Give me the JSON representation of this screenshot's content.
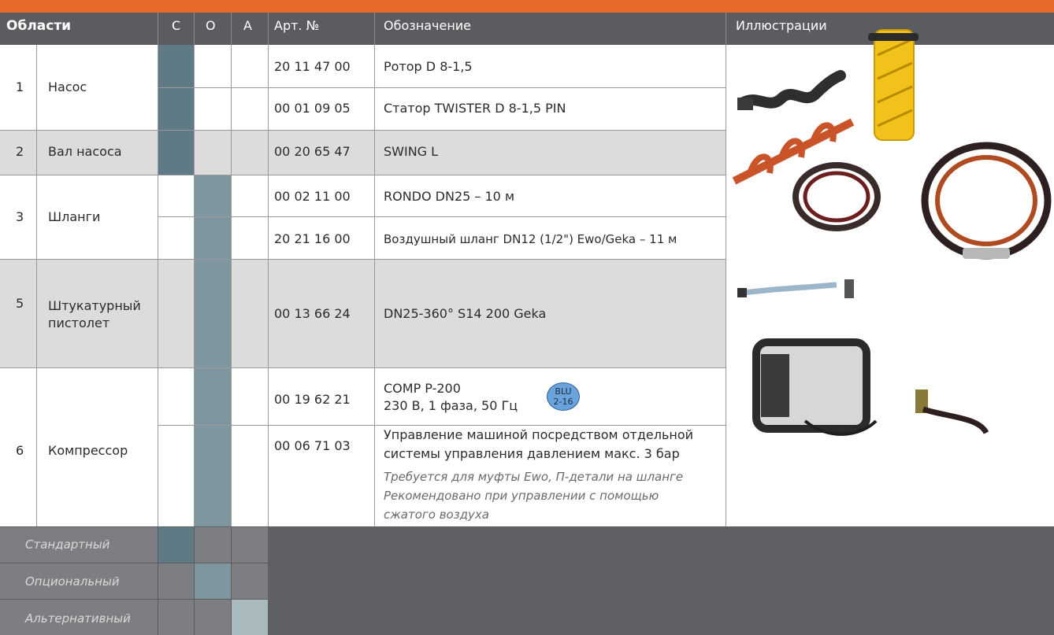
{
  "header": {
    "areas": "Области",
    "c": "С",
    "o": "О",
    "a": "А",
    "art": "Арт. №",
    "designation": "Обозначение",
    "illustrations": "Иллюстрации"
  },
  "rows": [
    {
      "num": "1",
      "area": "Насос",
      "items": [
        {
          "art": "20 11 47 00",
          "desc": "Ротор D 8-1,5"
        },
        {
          "art": "00 01 09 05",
          "desc": "Статор TWISTER D 8-1,5 PIN"
        }
      ]
    },
    {
      "num": "2",
      "area": "Вал насоса",
      "items": [
        {
          "art": "00 20 65 47",
          "desc": "SWING L"
        }
      ]
    },
    {
      "num": "3",
      "area": "Шланги",
      "items": [
        {
          "art": "00 02 11 00",
          "desc": "RONDO DN25 – 10 м"
        },
        {
          "art": "20 21 16 00",
          "desc": "Воздушный шланг DN12 (1/2\") Ewo/Geka – 11 м"
        }
      ]
    },
    {
      "num": "5",
      "area_line1": "Штукатурный",
      "area_line2": "пистолет",
      "items": [
        {
          "art": "00 13 66 24",
          "desc": "DN25-360° S14 200 Geka"
        }
      ]
    },
    {
      "num": "6",
      "area": "Компрессор",
      "items": [
        {
          "art": "00 19 62 21",
          "desc_line1": "COMP P-200",
          "desc_line2": "230 В, 1 фаза, 50 Гц",
          "badge_line1": "BLU",
          "badge_line2": "2-16"
        },
        {
          "art": "00 06 71 03",
          "desc_line1": "Управление машиной посредством отдельной",
          "desc_line2": "системы управления давлением макс. 3 бар",
          "note_line1": "Требуется для муфты Ewo, П-детали на шланге",
          "note_line2": "Рекомендовано при управлении с помощью",
          "note_line3": "сжатого воздуха"
        }
      ]
    }
  ],
  "legend": {
    "standard": "Стандартный",
    "optional": "Опциональный",
    "alternative": "Альтернативный"
  },
  "colors": {
    "accent": "#e8692a",
    "standard": "#5f7a84",
    "optional": "#7e969f",
    "alternative": "#a9babf"
  }
}
